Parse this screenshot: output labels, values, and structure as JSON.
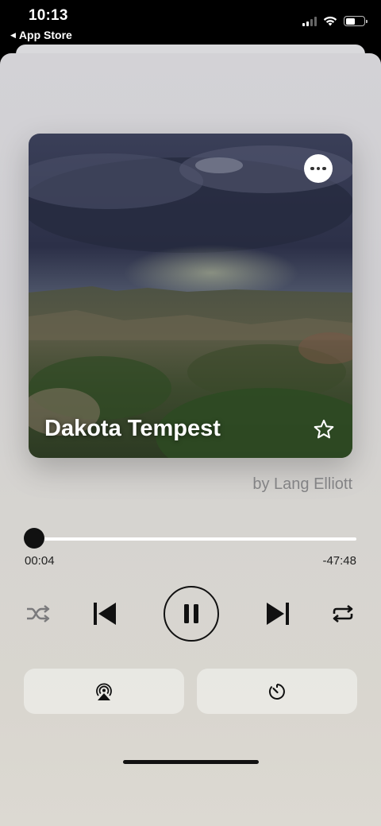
{
  "status_bar": {
    "time": "10:13",
    "back_label": "App Store",
    "battery_level": 0.5,
    "signal_bars": 2
  },
  "player": {
    "title": "Dakota Tempest",
    "artist": "by Lang Elliott",
    "elapsed": "00:04",
    "remaining": "-47:48",
    "progress": 0.0014
  },
  "icons": {
    "more": "more-icon",
    "favorite": "star-outline-icon",
    "shuffle": "shuffle-icon",
    "previous": "previous-track-icon",
    "pause": "pause-icon",
    "next": "next-track-icon",
    "repeat": "repeat-icon",
    "airplay": "airplay-icon",
    "timer": "sleep-timer-icon"
  },
  "colors": {
    "accent": "#111111",
    "muted": "#838385",
    "track": "#ffffff"
  }
}
